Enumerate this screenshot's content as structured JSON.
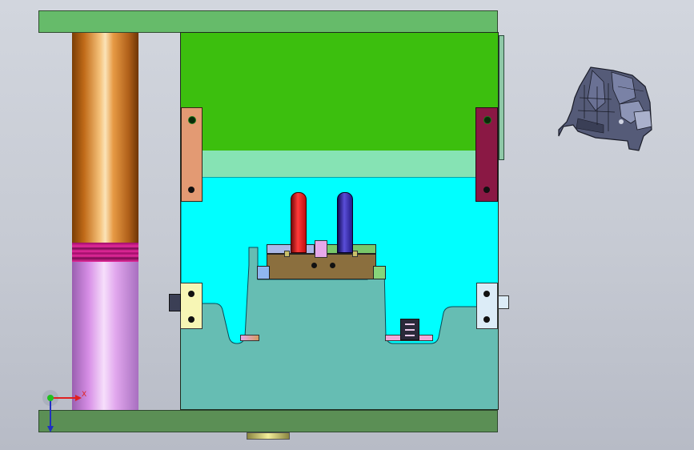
{
  "viewport": {
    "background_top": "#d2d6de",
    "background_bottom": "#b7bbc6"
  },
  "triad": {
    "x_label": "X",
    "y_label": "Y",
    "x_color": "#e02020",
    "y_color": "#20a020",
    "z_color": "#2030c0"
  },
  "colors": {
    "top_plate": "#66bb6a",
    "bottom_plate": "#5b8f55",
    "cavity_plate": "#3cbf0e",
    "stripper": "#86e3b4",
    "a_plate": "#00ffff",
    "core": "#66bdb3",
    "guide_pillar": "#d4882a",
    "guide_bushing": "#e6a6f0",
    "slider_base": "#8b6f3e",
    "pin_red": "#e02020",
    "pin_blue": "#2a1f9e",
    "lock_left": "#e39a73",
    "lock_right": "#8a1844",
    "block_yellow": "#f7f6b5",
    "block_light": "#dcecf7"
  },
  "preview": {
    "icon": "part-thumbnail-icon"
  }
}
